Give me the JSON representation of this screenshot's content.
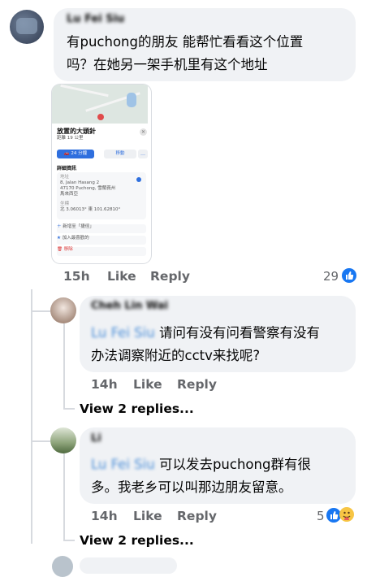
{
  "comment1": {
    "author": "Lu Fei Siu",
    "text_line1": "有puchong的朋友 能帮忙看看这个位置",
    "text_line2": "吗？在她另一架手机里有这个地址",
    "time": "15h",
    "like_label": "Like",
    "reply_label": "Reply",
    "reaction_count": "29"
  },
  "phone_shot": {
    "title": "放置的大頭針",
    "subtitle": "距離 19 公里",
    "drive_button": "24 分鐘",
    "share_button": "移動",
    "details_heading": "詳細資訊",
    "address_label": "地址",
    "address_line1": "8, Jalan Hasang 2",
    "address_line2": "47170 Puchong, 雪蘭莪州",
    "address_line3": "馬來西亞",
    "coords_label": "坐標",
    "coords": "北 3.06013° 東 101.62810°",
    "action1": "新增至「捷徑」",
    "action2": "加入最喜歡的",
    "action3": "移除"
  },
  "reply1": {
    "author": "Cheh Lin Wai",
    "mention": "Lu Fei Siu",
    "text_line1": "请问有没有问看警察有没有",
    "text_line2": "办法调察附近的cctv来找呢?",
    "time": "14h",
    "like_label": "Like",
    "reply_label": "Reply",
    "view_replies": "View 2 replies..."
  },
  "reply2": {
    "author": "Li",
    "mention": "Lu Fei Siu",
    "text_line1": "可以发去puchong群有很",
    "text_line2": "多。我老乡可以叫那边朋友留意。",
    "time": "14h",
    "like_label": "Like",
    "reply_label": "Reply",
    "reaction_count": "5",
    "view_replies": "View 2 replies..."
  },
  "colors": {
    "bubble": "#f0f2f5",
    "like_blue": "#1877f2",
    "mention": "#4a8ed8",
    "muted": "#65676b"
  }
}
